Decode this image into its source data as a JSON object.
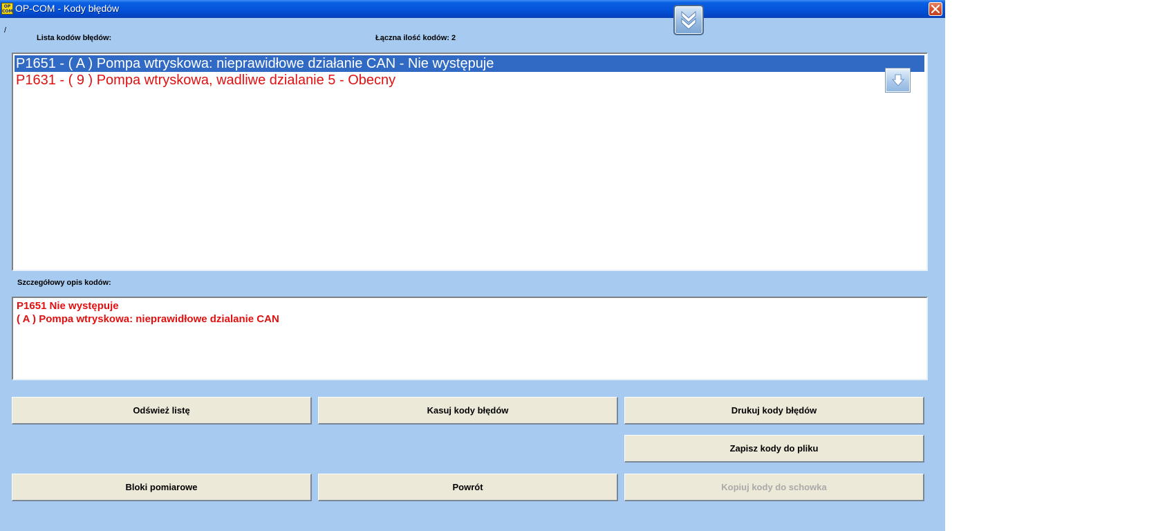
{
  "window": {
    "title": "OP-COM - Kody błędów",
    "logo_text": "OP COM"
  },
  "header": {
    "slash": "/",
    "list_label": "Lista kodów błędów:",
    "count_label": "Łączna ilość kodów: 2"
  },
  "codes_list": {
    "items": [
      {
        "text": "P1651 - ( A )  Pompa wtryskowa: nieprawidłowe działanie CAN - Nie występuje",
        "selected": true
      },
      {
        "text": "P1631 - ( 9 )  Pompa wtryskowa, wadliwe dzialanie 5 - Obecny",
        "selected": false
      }
    ]
  },
  "details": {
    "label": "Szczegółowy opis kodów:",
    "lines": [
      "P1651  Nie występuje",
      "( A )  Pompa wtryskowa: nieprawidłowe dzialanie CAN"
    ]
  },
  "buttons": {
    "refresh": "Odśwież listę",
    "clear": "Kasuj kody błędów",
    "print": "Drukuj kody błędów",
    "save": "Zapisz kody do pliku",
    "blocks": "Bloki pomiarowe",
    "back": "Powrót",
    "copy": "Kopiuj kody do schowka"
  },
  "colors": {
    "background": "#a6caf0",
    "selection": "#316ac5",
    "error_text": "#e01010",
    "button_face": "#ece9d8",
    "disabled_text": "#a9a9a9"
  },
  "icons": {
    "close": "close-icon",
    "collapse": "double-chevron-down-icon",
    "scroll_down": "arrow-down-icon",
    "logo": "opcom-logo-icon"
  }
}
